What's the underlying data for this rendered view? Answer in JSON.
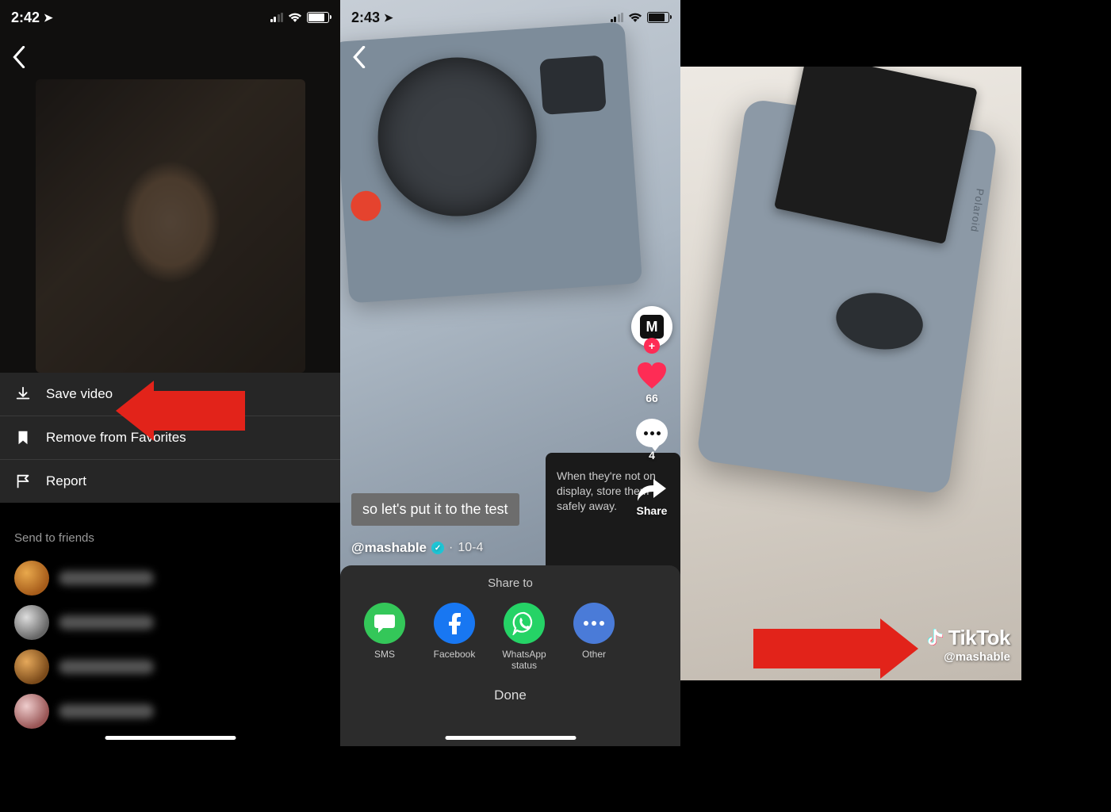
{
  "panel1": {
    "status_time": "2:42",
    "menu": {
      "save_video": "Save video",
      "remove_favorites": "Remove from Favorites",
      "report": "Report"
    },
    "send_to_friends_title": "Send to friends"
  },
  "panel2": {
    "status_time": "2:43",
    "packet_text": "When they're not on display, store them safely away.",
    "caption": "so let's put it to the test",
    "username": "@mashable",
    "date_sep": "·",
    "date": "10-4",
    "avatar_letter": "M",
    "like_count": "66",
    "comment_count": "4",
    "share_label": "Share",
    "share_sheet": {
      "title": "Share to",
      "sms": "SMS",
      "facebook": "Facebook",
      "whatsapp": "WhatsApp status",
      "other": "Other",
      "done": "Done"
    }
  },
  "panel3": {
    "polaroid_label": "Polaroid",
    "watermark_brand": "TikTok",
    "watermark_user": "@mashable"
  },
  "icon_plus": "+",
  "colors": {
    "tiktok_red": "#fe2c55",
    "annotation_red": "#e2231a",
    "sms_green": "#34c759",
    "facebook_blue": "#1877f2",
    "whatsapp_green": "#25d366"
  }
}
